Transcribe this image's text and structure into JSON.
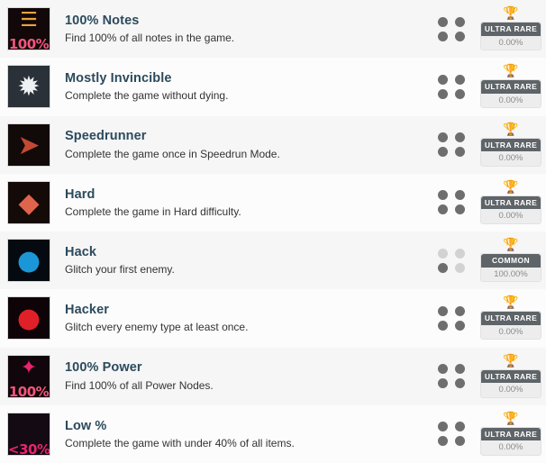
{
  "list": {
    "rows": [
      {
        "title": "100% Notes",
        "description": "Find 100% of all notes in the game.",
        "icon_name": "scroll-notes-icon",
        "icon_text": "100%",
        "icon_glyph": "☰",
        "icon_glyph_color": "#e8a33d",
        "icon_text_color": "#f2567d",
        "icon_bg": "#120709",
        "trophy_color": "#b8481c",
        "rarity": "ULTRA RARE",
        "percent": "0.00%",
        "dots": [
          "dark",
          "dark",
          "dark",
          "dark"
        ]
      },
      {
        "title": "Mostly Invincible",
        "description": "Complete the game without dying.",
        "icon_name": "explosion-burst-icon",
        "icon_text": "",
        "icon_glyph": "✹",
        "icon_glyph_color": "#eef2f4",
        "icon_text_color": "#ffffff",
        "icon_bg": "#2b3138",
        "trophy_color": "#d9a227",
        "rarity": "ULTRA RARE",
        "percent": "0.00%",
        "dots": [
          "dark",
          "dark",
          "dark",
          "dark"
        ]
      },
      {
        "title": "Speedrunner",
        "description": "Complete the game once in Speedrun Mode.",
        "icon_name": "running-character-icon",
        "icon_text": "",
        "icon_glyph": "➤",
        "icon_glyph_color": "#c24a32",
        "icon_text_color": "#ffffff",
        "icon_bg": "#120a08",
        "trophy_color": "#d9a227",
        "rarity": "ULTRA RARE",
        "percent": "0.00%",
        "dots": [
          "dark",
          "dark",
          "dark",
          "dark"
        ]
      },
      {
        "title": "Hard",
        "description": "Complete the game in Hard difficulty.",
        "icon_name": "creature-boss-icon",
        "icon_text": "",
        "icon_glyph": "◆",
        "icon_glyph_color": "#e0644c",
        "icon_text_color": "#ffffff",
        "icon_bg": "#140a08",
        "trophy_color": "#d9a227",
        "rarity": "ULTRA RARE",
        "percent": "0.00%",
        "dots": [
          "dark",
          "dark",
          "dark",
          "dark"
        ]
      },
      {
        "title": "Hack",
        "description": "Glitch your first enemy.",
        "icon_name": "blue-enemy-orb-icon",
        "icon_text": "",
        "icon_glyph": "●",
        "icon_glyph_color": "#1b97d8",
        "icon_text_color": "#ffffff",
        "icon_bg": "#050a10",
        "trophy_color": "#b8481c",
        "rarity": "COMMON",
        "percent": "100.00%",
        "dots": [
          "light",
          "light",
          "dark",
          "light"
        ]
      },
      {
        "title": "Hacker",
        "description": "Glitch every enemy type at least once.",
        "icon_name": "red-enemy-orb-icon",
        "icon_text": "",
        "icon_glyph": "●",
        "icon_glyph_color": "#e02028",
        "icon_text_color": "#ffffff",
        "icon_bg": "#0e0407",
        "trophy_color": "#b8481c",
        "rarity": "ULTRA RARE",
        "percent": "0.00%",
        "dots": [
          "dark",
          "dark",
          "dark",
          "dark"
        ]
      },
      {
        "title": "100% Power",
        "description": "Find 100% of all Power Nodes.",
        "icon_name": "power-node-icon",
        "icon_text": "100%",
        "icon_glyph": "✦",
        "icon_glyph_color": "#e8246e",
        "icon_text_color": "#f2567d",
        "icon_bg": "#11060b",
        "trophy_color": "#b8481c",
        "rarity": "ULTRA RARE",
        "percent": "0.00%",
        "dots": [
          "dark",
          "dark",
          "dark",
          "dark"
        ]
      },
      {
        "title": "Low %",
        "description": "Complete the game with under 40% of all items.",
        "icon_name": "low-percent-icon",
        "icon_text": "<30%",
        "icon_glyph": "",
        "icon_glyph_color": "#7a2f55",
        "icon_text_color": "#e8246e",
        "icon_bg": "#140a14",
        "trophy_color": "#d9a227",
        "rarity": "ULTRA RARE",
        "percent": "0.00%",
        "dots": [
          "dark",
          "dark",
          "dark",
          "dark"
        ]
      }
    ]
  }
}
